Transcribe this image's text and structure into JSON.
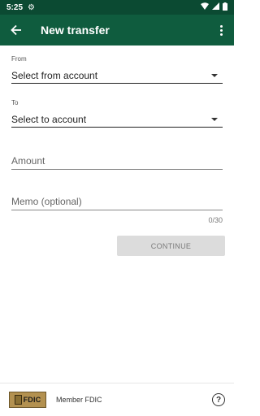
{
  "status_bar": {
    "time": "5:25",
    "icons": [
      "gear-icon",
      "wifi-icon",
      "signal-icon",
      "battery-icon"
    ]
  },
  "app_bar": {
    "title": "New transfer",
    "back_icon": "arrow-back-icon",
    "menu_icon": "more-vert-icon"
  },
  "form": {
    "from": {
      "label": "From",
      "value": "Select from account"
    },
    "to": {
      "label": "To",
      "value": "Select to account"
    },
    "amount": {
      "placeholder": "Amount"
    },
    "memo": {
      "placeholder": "Memo (optional)",
      "counter": "0/30"
    },
    "continue_label": "CONTINUE"
  },
  "footer": {
    "logo_text": "FDIC",
    "member_text": "Member FDIC",
    "help_icon": "help-circle-icon"
  },
  "colors": {
    "status_bar": "#0b4a32",
    "app_bar": "#0f5c3e",
    "button_disabled": "#dcdcdc",
    "fdic_gold": "#b39150"
  }
}
